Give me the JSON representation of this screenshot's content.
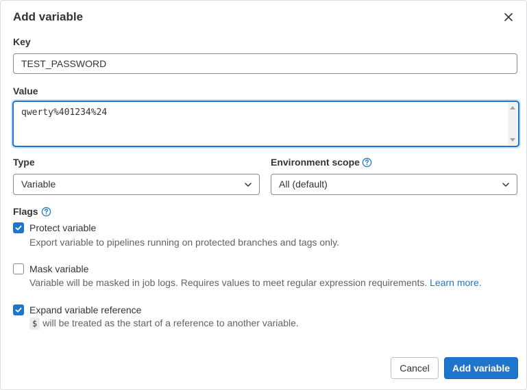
{
  "modal": {
    "title": "Add variable"
  },
  "key": {
    "label": "Key",
    "value": "TEST_PASSWORD"
  },
  "value_field": {
    "label": "Value",
    "value": "qwerty%401234%24"
  },
  "type": {
    "label": "Type",
    "selected": "Variable"
  },
  "environment_scope": {
    "label": "Environment scope",
    "selected": "All (default)"
  },
  "flags": {
    "label": "Flags",
    "items": [
      {
        "title": "Protect variable",
        "description": "Export variable to pipelines running on protected branches and tags only.",
        "checked": true
      },
      {
        "title": "Mask variable",
        "description": "Variable will be masked in job logs. Requires values to meet regular expression requirements.",
        "link": "Learn more.",
        "checked": false
      },
      {
        "title": "Expand variable reference",
        "code": "$",
        "description": "will be treated as the start of a reference to another variable.",
        "checked": true
      }
    ]
  },
  "buttons": {
    "cancel": "Cancel",
    "add": "Add variable"
  },
  "colors": {
    "primary": "#1f75cb",
    "text": "#333238",
    "muted": "#626168"
  }
}
